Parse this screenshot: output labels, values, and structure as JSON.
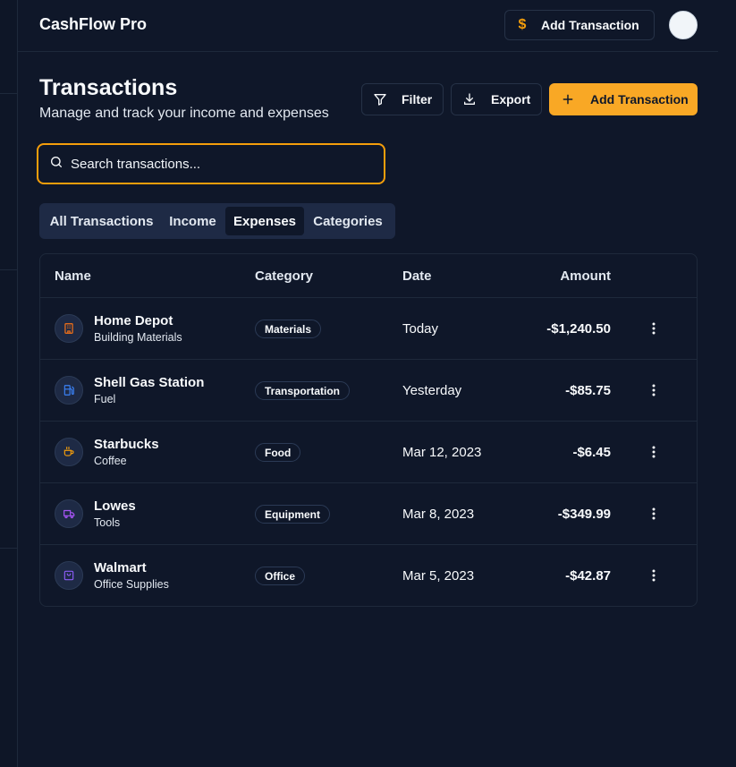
{
  "app": {
    "name": "CashFlow Pro"
  },
  "topbar": {
    "add_label": "Add Transaction",
    "add_icon": "dollar-icon"
  },
  "header": {
    "title": "Transactions",
    "subtitle": "Manage and track your income and expenses",
    "filter_label": "Filter",
    "export_label": "Export",
    "add_label": "Add Transaction"
  },
  "search": {
    "placeholder": "Search transactions...",
    "value": ""
  },
  "tabs": [
    {
      "label": "All Transactions",
      "active": false
    },
    {
      "label": "Income",
      "active": false
    },
    {
      "label": "Expenses",
      "active": true
    },
    {
      "label": "Categories",
      "active": false
    }
  ],
  "table": {
    "columns": [
      "Name",
      "Category",
      "Date",
      "Amount"
    ],
    "rows": [
      {
        "name": "Home Depot",
        "sub": "Building Materials",
        "category": "Materials",
        "date": "Today",
        "amount": "-$1,240.50",
        "icon": "building-icon",
        "icon_color": "#f97316"
      },
      {
        "name": "Shell Gas Station",
        "sub": "Fuel",
        "category": "Transportation",
        "date": "Yesterday",
        "amount": "-$85.75",
        "icon": "fuel-icon",
        "icon_color": "#3b82f6"
      },
      {
        "name": "Starbucks",
        "sub": "Coffee",
        "category": "Food",
        "date": "Mar 12, 2023",
        "amount": "-$6.45",
        "icon": "coffee-icon",
        "icon_color": "#f59e0b"
      },
      {
        "name": "Lowes",
        "sub": "Tools",
        "category": "Equipment",
        "date": "Mar 8, 2023",
        "amount": "-$349.99",
        "icon": "truck-icon",
        "icon_color": "#a855f7"
      },
      {
        "name": "Walmart",
        "sub": "Office Supplies",
        "category": "Office",
        "date": "Mar 5, 2023",
        "amount": "-$42.87",
        "icon": "shopping-bag-icon",
        "icon_color": "#8b5cf6"
      }
    ]
  },
  "colors": {
    "accent": "#f9a825",
    "background": "#0f1729",
    "surface": "#1e2a45"
  }
}
